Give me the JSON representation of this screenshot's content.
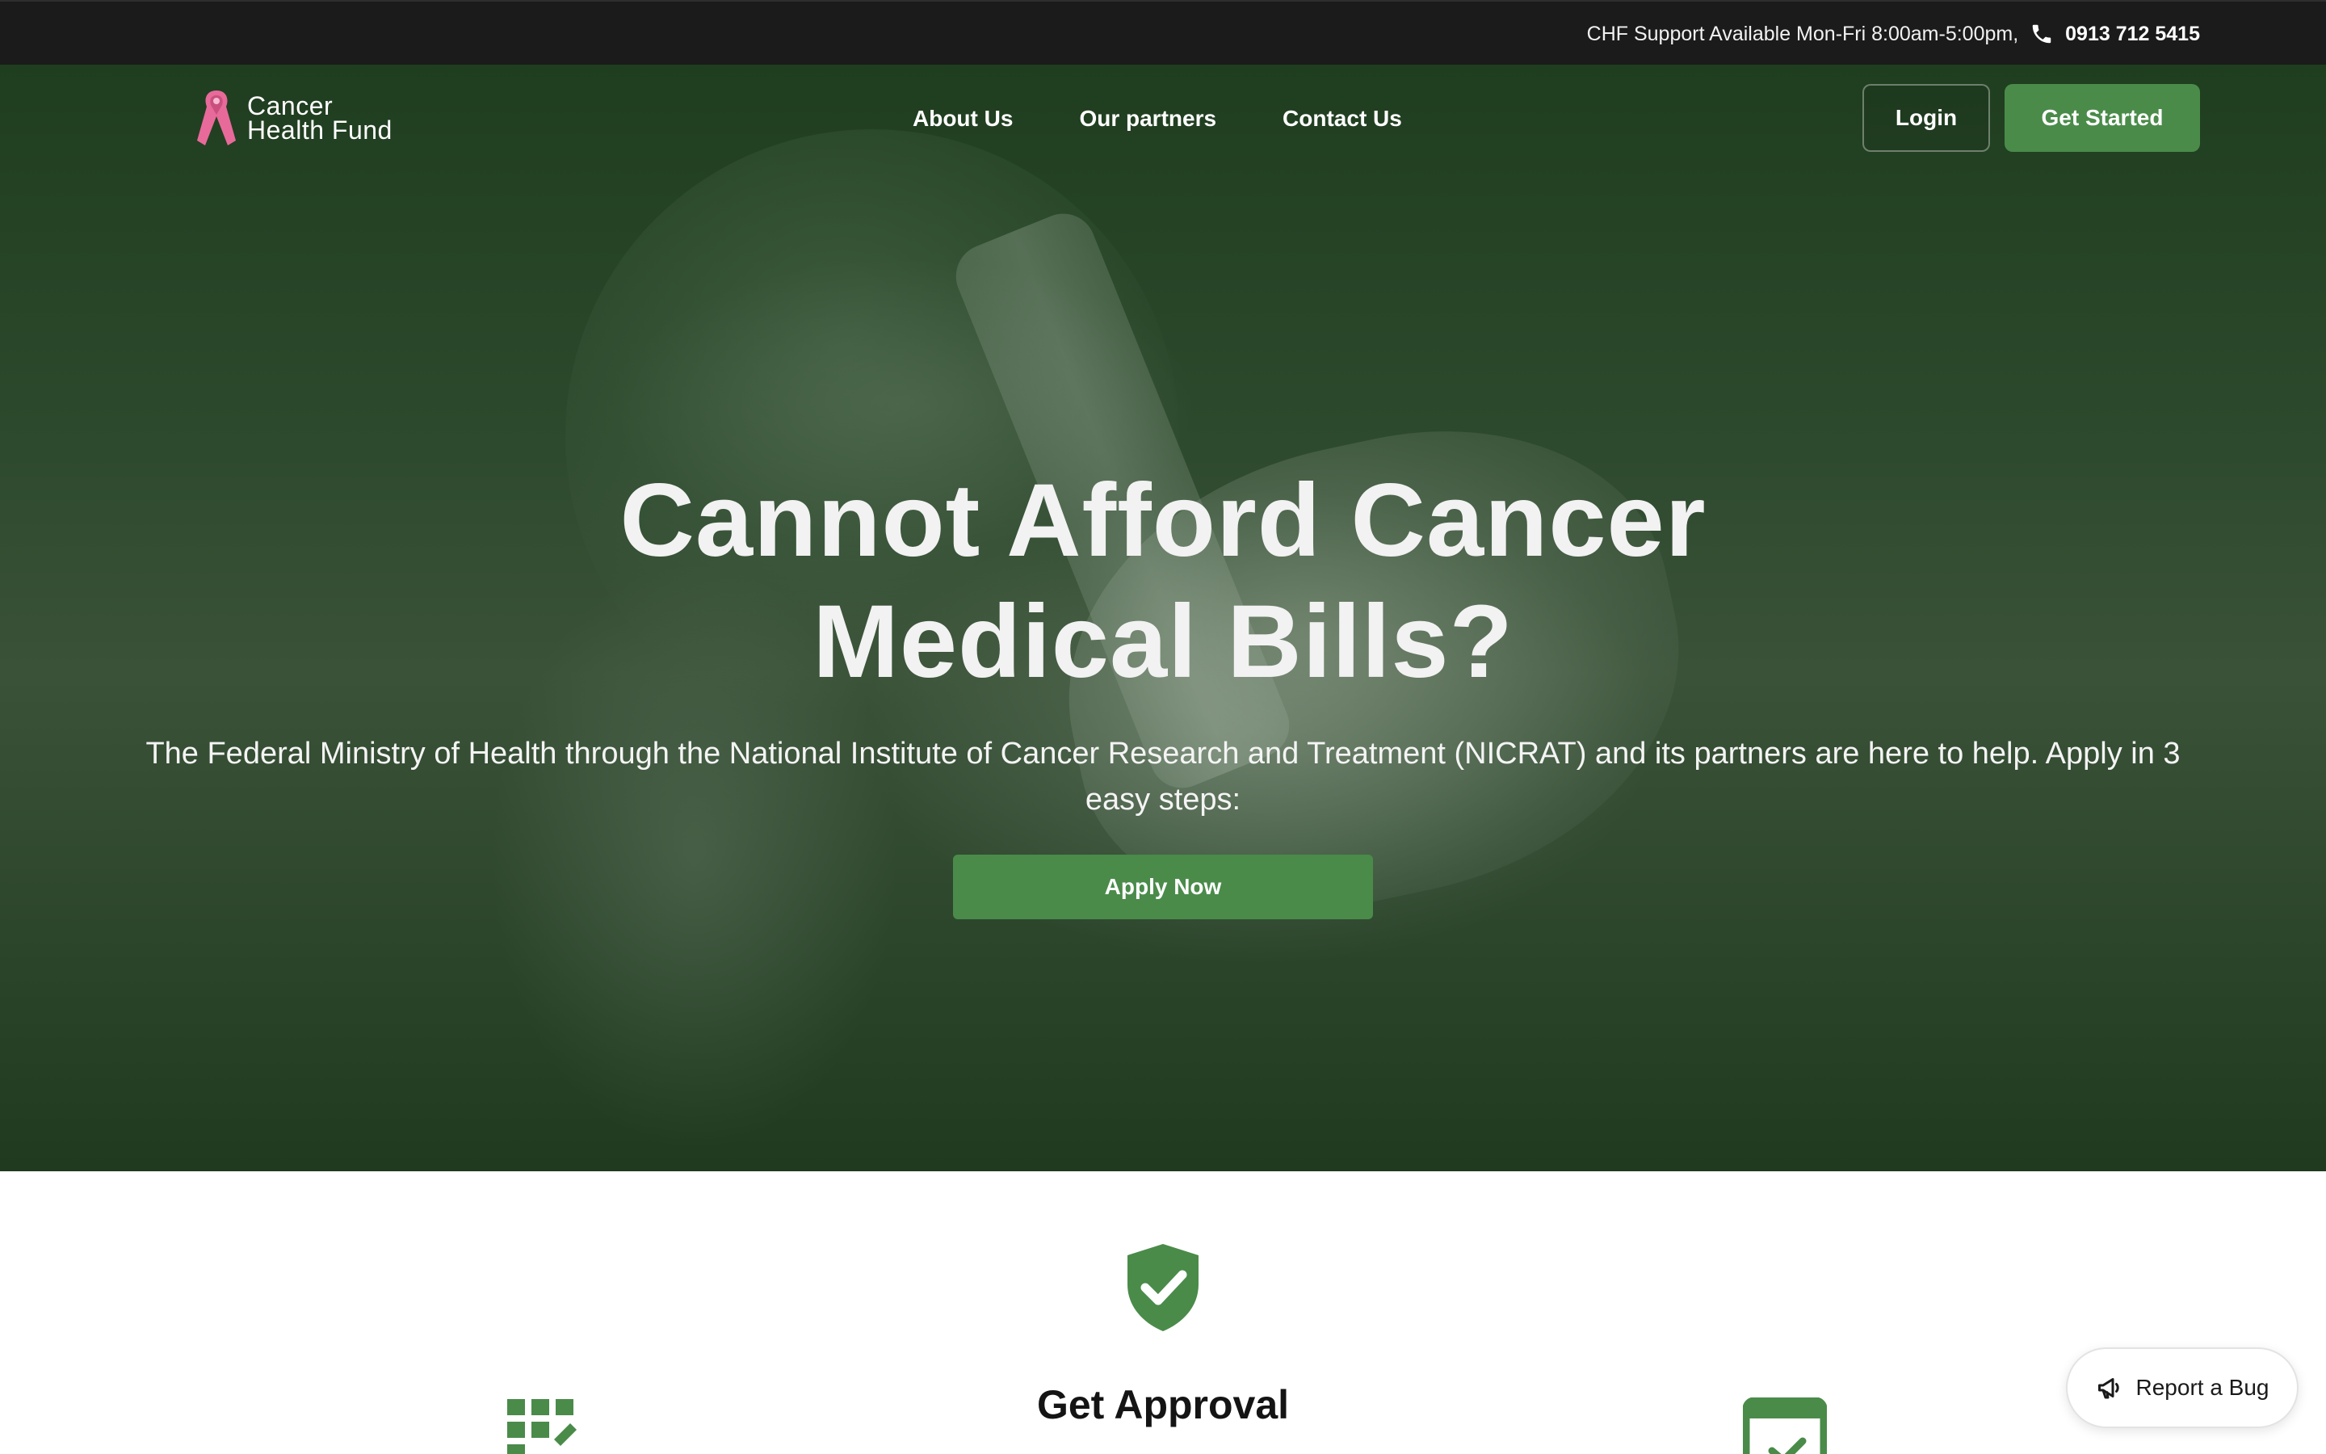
{
  "topbar": {
    "support_text": "CHF Support Available Mon-Fri 8:00am-5:00pm,",
    "phone_icon": "phone-icon",
    "phone_number": "0913 712 5415"
  },
  "header": {
    "logo_line1": "Cancer",
    "logo_line2": "Health Fund",
    "logo_icon": "pink-ribbon",
    "nav": [
      "About Us",
      "Our partners",
      "Contact Us"
    ],
    "login_label": "Login",
    "get_started_label": "Get Started"
  },
  "hero": {
    "title_line1": "Cannot Afford Cancer",
    "title_line2": "Medical Bills?",
    "subtitle": "The Federal Ministry of Health through the National Institute of Cancer Research and Treatment (NICRAT) and its partners are here to help. Apply in 3 easy steps:",
    "apply_label": "Apply Now"
  },
  "steps": {
    "center_title": "Get Approval",
    "icons": [
      "grid-edit-icon",
      "shield-check-icon",
      "calendar-check-icon"
    ]
  },
  "report_bug": {
    "label": "Report a Bug",
    "icon": "megaphone-icon"
  },
  "colors": {
    "brand_green": "#4a8b4a",
    "topbar_bg": "#1b1b1b",
    "ribbon_pink": "#e86a9a"
  }
}
